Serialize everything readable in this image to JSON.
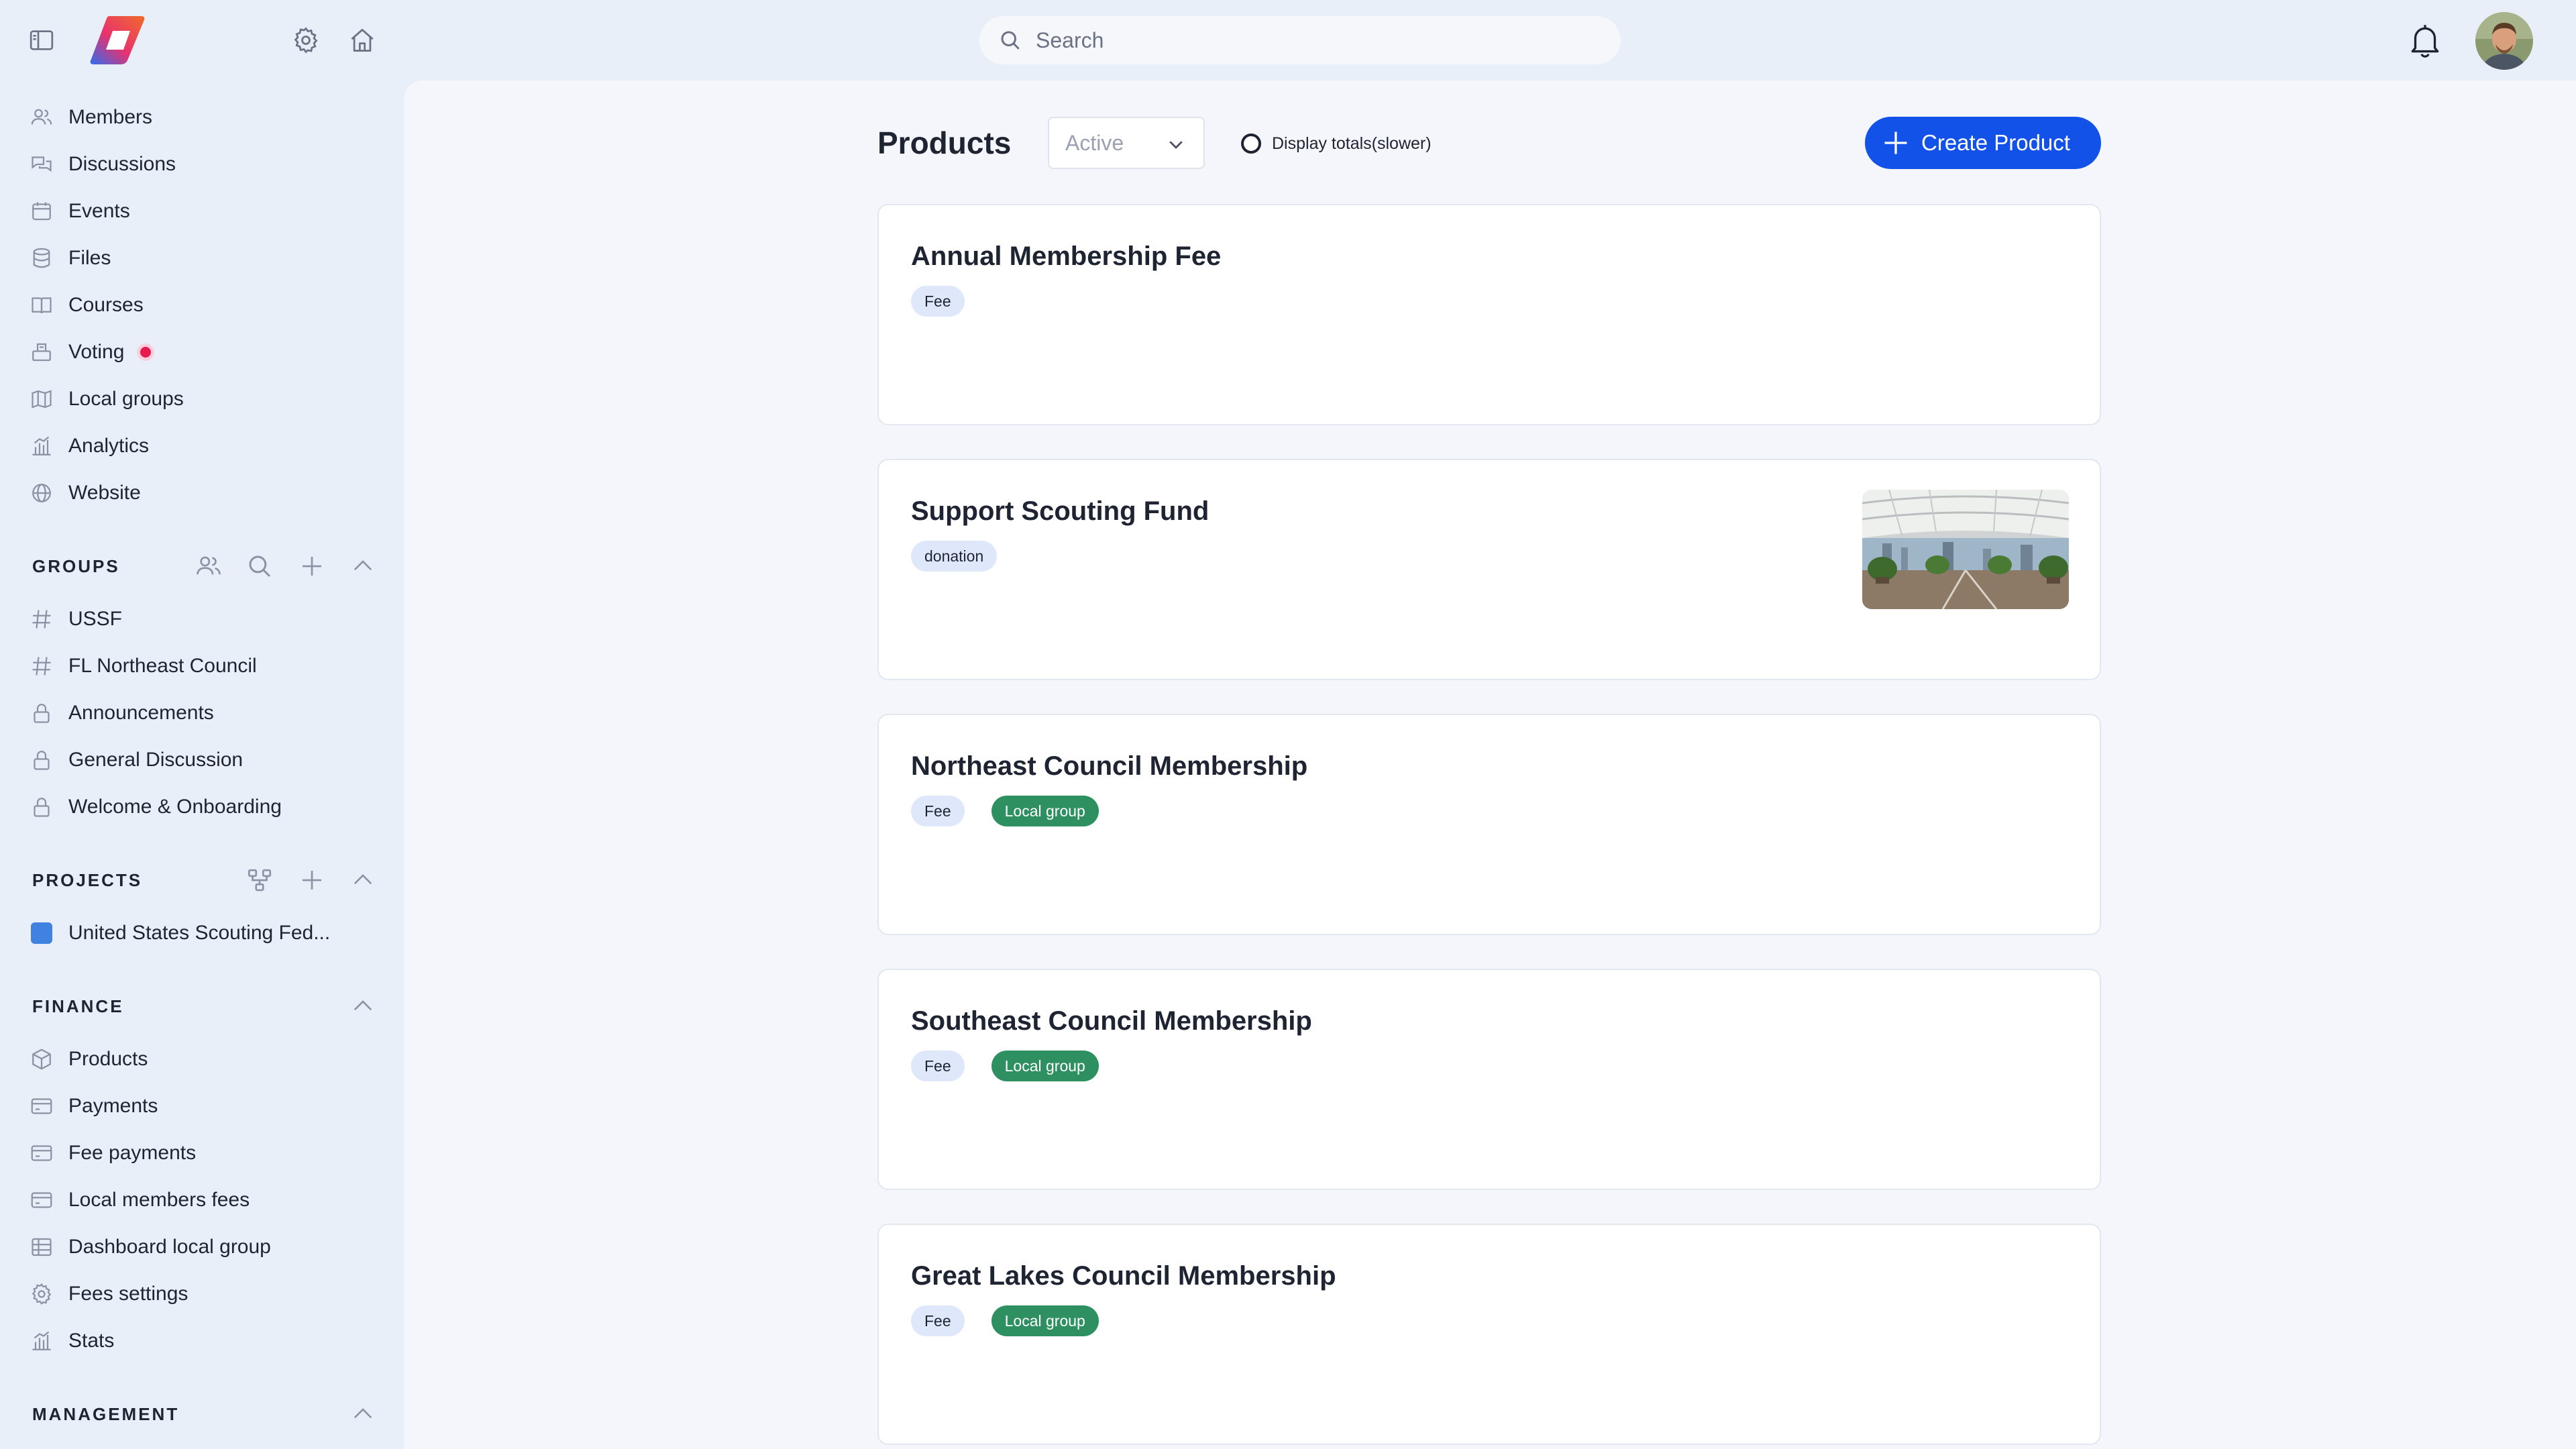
{
  "search": {
    "placeholder": "Search"
  },
  "sidebar": {
    "nav": [
      {
        "label": "Members",
        "icon": "users-icon"
      },
      {
        "label": "Discussions",
        "icon": "chat-icon"
      },
      {
        "label": "Events",
        "icon": "calendar-icon"
      },
      {
        "label": "Files",
        "icon": "database-icon"
      },
      {
        "label": "Courses",
        "icon": "book-icon"
      },
      {
        "label": "Voting",
        "icon": "ballot-box-icon",
        "badge": "dot"
      },
      {
        "label": "Local groups",
        "icon": "map-icon"
      },
      {
        "label": "Analytics",
        "icon": "bar-chart-icon"
      },
      {
        "label": "Website",
        "icon": "globe-icon"
      }
    ],
    "groups": {
      "title": "GROUPS",
      "items": [
        {
          "label": "USSF",
          "icon": "hash-icon"
        },
        {
          "label": "FL Northeast Council",
          "icon": "hash-icon"
        },
        {
          "label": "Announcements",
          "icon": "lock-icon"
        },
        {
          "label": "General Discussion",
          "icon": "lock-icon"
        },
        {
          "label": "Welcome & Onboarding",
          "icon": "lock-icon"
        }
      ]
    },
    "projects": {
      "title": "PROJECTS",
      "items": [
        {
          "label": "United States Scouting Fed...",
          "color": "#3f82e0"
        }
      ]
    },
    "finance": {
      "title": "FINANCE",
      "items": [
        {
          "label": "Products",
          "icon": "box-icon"
        },
        {
          "label": "Payments",
          "icon": "credit-card-icon"
        },
        {
          "label": "Fee payments",
          "icon": "credit-card-icon"
        },
        {
          "label": "Local members fees",
          "icon": "credit-card-icon"
        },
        {
          "label": "Dashboard local group",
          "icon": "table-icon"
        },
        {
          "label": "Fees settings",
          "icon": "gear-icon"
        },
        {
          "label": "Stats",
          "icon": "bar-chart-icon"
        }
      ]
    },
    "management": {
      "title": "MANAGEMENT"
    }
  },
  "main": {
    "title": "Products",
    "status_filter": "Active",
    "totals_label": "Display totals(slower)",
    "create_label": "Create Product",
    "products": [
      {
        "title": "Annual Membership Fee",
        "tags": [
          "Fee"
        ]
      },
      {
        "title": "Support Scouting Fund",
        "tags": [
          "donation"
        ],
        "has_image": true
      },
      {
        "title": "Northeast Council Membership",
        "tags": [
          "Fee",
          "Local group"
        ]
      },
      {
        "title": "Southeast Council Membership",
        "tags": [
          "Fee",
          "Local group"
        ]
      },
      {
        "title": "Great Lakes Council Membership",
        "tags": [
          "Fee",
          "Local group"
        ]
      }
    ]
  },
  "colors": {
    "accent": "#1352e8",
    "local_tag": "#2e9061",
    "fee_tag": "#dfe8fb",
    "badge": "#e8194f"
  }
}
